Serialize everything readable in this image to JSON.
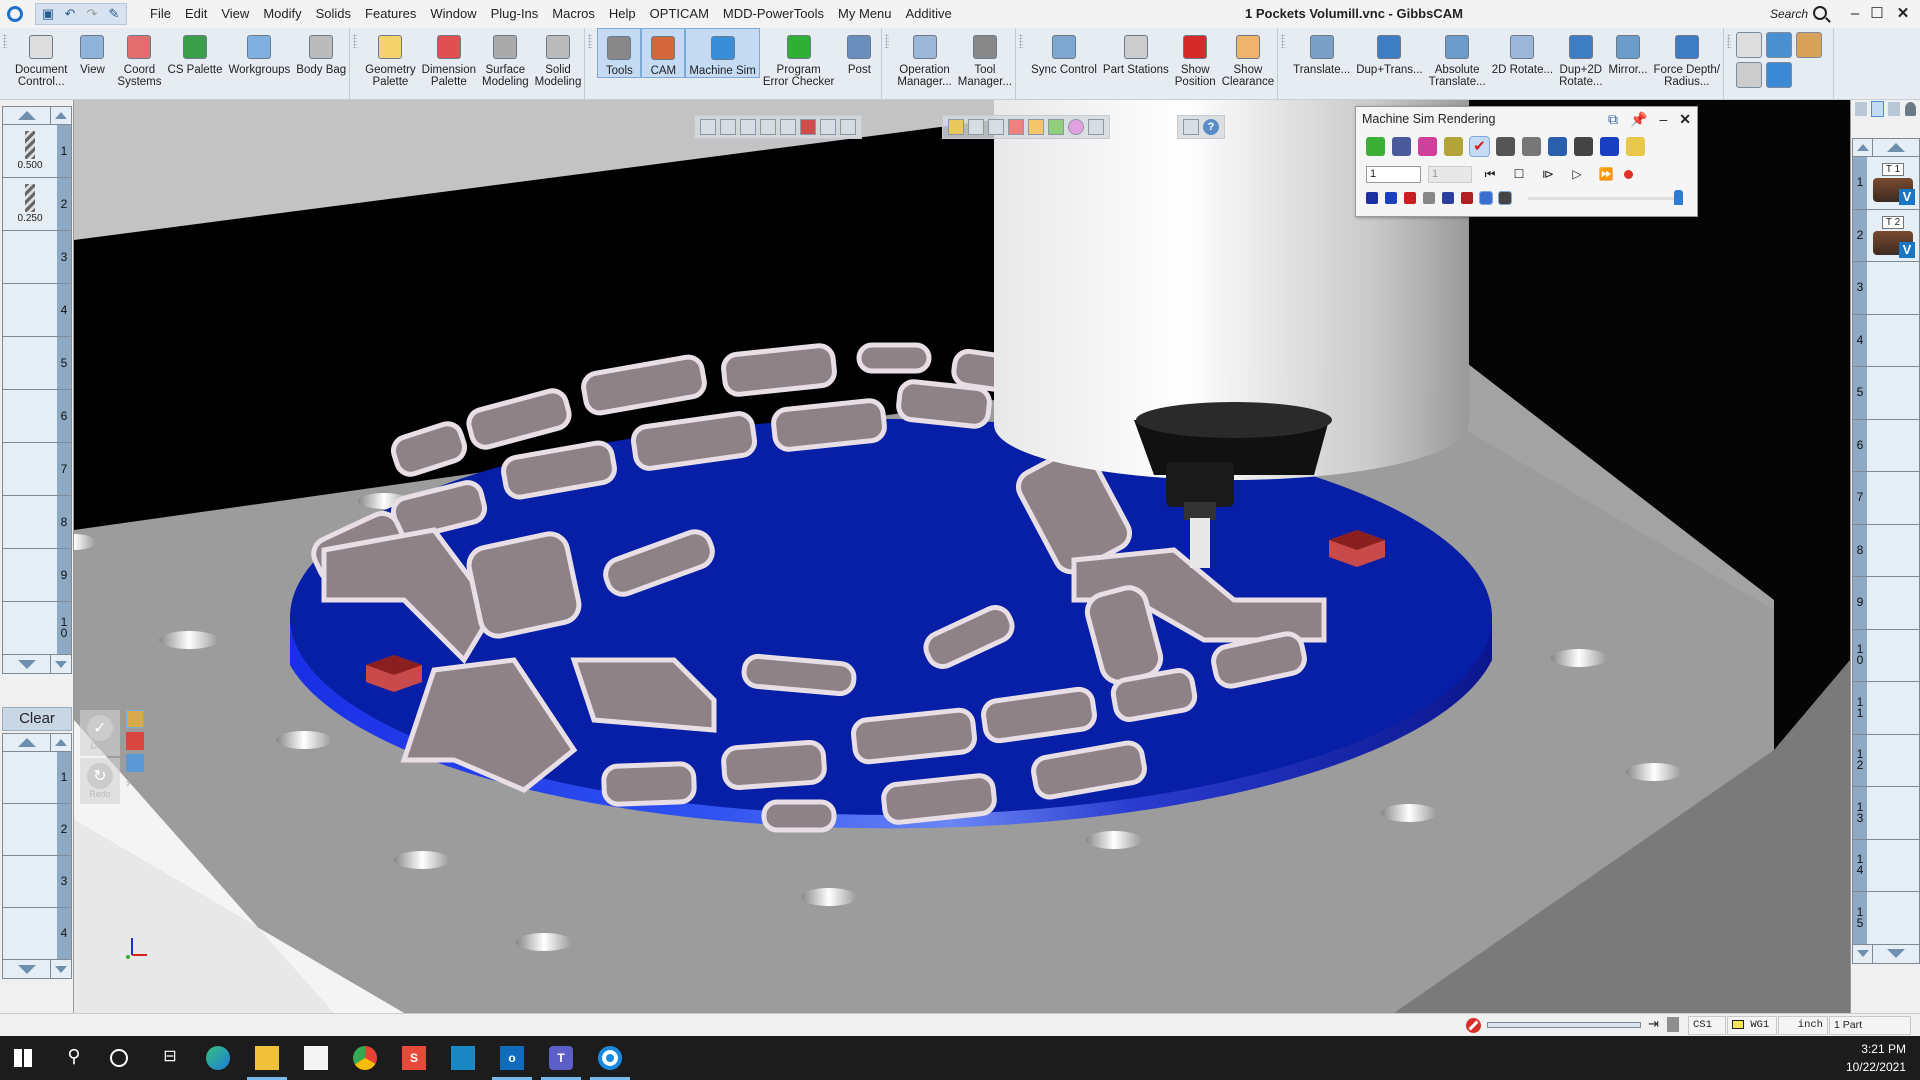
{
  "window": {
    "title": "1 Pockets Volumill.vnc - GibbsCAM",
    "search_label": "Search"
  },
  "menu": [
    "File",
    "Edit",
    "View",
    "Modify",
    "Solids",
    "Features",
    "Window",
    "Plug-Ins",
    "Macros",
    "Help",
    "OPTICAM",
    "MDD-PowerTools",
    "My Menu",
    "Additive"
  ],
  "ribbon": {
    "groups": [
      {
        "buttons": [
          {
            "label": "Document\nControl...",
            "icon": "document-control-icon"
          },
          {
            "label": "View",
            "icon": "view-sphere-icon"
          },
          {
            "label": "Coord\nSystems",
            "icon": "coord-systems-icon"
          },
          {
            "label": "CS Palette",
            "icon": "cs-palette-icon"
          },
          {
            "label": "Workgroups",
            "icon": "workgroups-icon"
          },
          {
            "label": "Body Bag",
            "icon": "body-bag-icon"
          }
        ]
      },
      {
        "buttons": [
          {
            "label": "Geometry\nPalette",
            "icon": "geometry-palette-icon"
          },
          {
            "label": "Dimension\nPalette",
            "icon": "dimension-palette-icon"
          },
          {
            "label": "Surface\nModeling",
            "icon": "surface-modeling-icon"
          },
          {
            "label": "Solid\nModeling",
            "icon": "solid-modeling-icon"
          }
        ]
      },
      {
        "buttons": [
          {
            "label": "Tools",
            "icon": "tools-icon",
            "active": true
          },
          {
            "label": "CAM",
            "icon": "cam-icon",
            "active": true
          },
          {
            "label": "Machine Sim",
            "icon": "machine-sim-icon",
            "active": true
          },
          {
            "label": "Program\nError Checker",
            "icon": "error-checker-icon"
          },
          {
            "label": "Post",
            "icon": "post-icon"
          }
        ]
      },
      {
        "buttons": [
          {
            "label": "Operation\nManager...",
            "icon": "operation-manager-icon"
          },
          {
            "label": "Tool\nManager...",
            "icon": "tool-manager-icon"
          }
        ]
      },
      {
        "buttons": [
          {
            "label": "Sync Control",
            "icon": "sync-control-icon"
          },
          {
            "label": "Part Stations",
            "icon": "part-stations-icon"
          },
          {
            "label": "Show\nPosition",
            "icon": "show-position-icon"
          },
          {
            "label": "Show\nClearance",
            "icon": "show-clearance-icon"
          }
        ]
      },
      {
        "buttons": [
          {
            "label": "Translate...",
            "icon": "translate-icon"
          },
          {
            "label": "Dup+Trans...",
            "icon": "dup-translate-icon"
          },
          {
            "label": "Absolute\nTranslate...",
            "icon": "absolute-translate-icon"
          },
          {
            "label": "2D Rotate...",
            "icon": "rotate-2d-icon"
          },
          {
            "label": "Dup+2D\nRotate...",
            "icon": "dup-rotate-2d-icon"
          },
          {
            "label": "Mirror...",
            "icon": "mirror-icon"
          },
          {
            "label": "Force Depth/\nRadius...",
            "icon": "force-depth-icon"
          }
        ]
      }
    ]
  },
  "tool_list": {
    "slots": [
      {
        "num": "1",
        "diameter": "0.500",
        "has_tool": true
      },
      {
        "num": "2",
        "diameter": "0.250",
        "has_tool": true
      },
      {
        "num": "3"
      },
      {
        "num": "4"
      },
      {
        "num": "5"
      },
      {
        "num": "6"
      },
      {
        "num": "7"
      },
      {
        "num": "8"
      },
      {
        "num": "9"
      },
      {
        "num": "1\n0"
      }
    ]
  },
  "clear_button": "Clear",
  "process_list": {
    "slots": [
      "1",
      "2",
      "3",
      "4"
    ]
  },
  "floating": {
    "do_it": "Do It",
    "redo": "Redo"
  },
  "operations": {
    "slots": [
      {
        "num": "1",
        "tag": "T 1",
        "has_op": true
      },
      {
        "num": "2",
        "tag": "T 2",
        "has_op": true
      },
      {
        "num": "3"
      },
      {
        "num": "4"
      },
      {
        "num": "5"
      },
      {
        "num": "6"
      },
      {
        "num": "7"
      },
      {
        "num": "8"
      },
      {
        "num": "9"
      },
      {
        "num": "1\n0"
      },
      {
        "num": "1\n1"
      },
      {
        "num": "1\n2"
      },
      {
        "num": "1\n3"
      },
      {
        "num": "1\n4"
      },
      {
        "num": "1\n5"
      }
    ]
  },
  "sim_panel": {
    "title": "Machine Sim Rendering",
    "step_value": "1",
    "combo_value": "1",
    "speed_fraction": 1.0,
    "toolbar_icons": [
      "stop-hand-icon",
      "stock-icon",
      "color-icon",
      "collision-icon",
      "check-icon",
      "lock-icon",
      "xyz-readout-icon",
      "list-icon",
      "eye-icon",
      "solid-icon",
      "folder-icon"
    ],
    "display_icons": [
      "fixture-icon",
      "blue-solid-icon",
      "red-solid-icon",
      "cylinder-icon",
      "machine-icon",
      "tool-t-icon",
      "bar-icon",
      "visibility-icon"
    ]
  },
  "statusbar": {
    "cs": "CS1",
    "wg": "WG1",
    "units": "inch",
    "parts": "1 Part"
  },
  "taskbar": {
    "time": "3:21 PM",
    "date": "10/22/2021"
  },
  "colors": {
    "part_blue": "#0a1eb4",
    "fixture_gray": "#8a8a8a",
    "accent": "#1e73c8"
  }
}
